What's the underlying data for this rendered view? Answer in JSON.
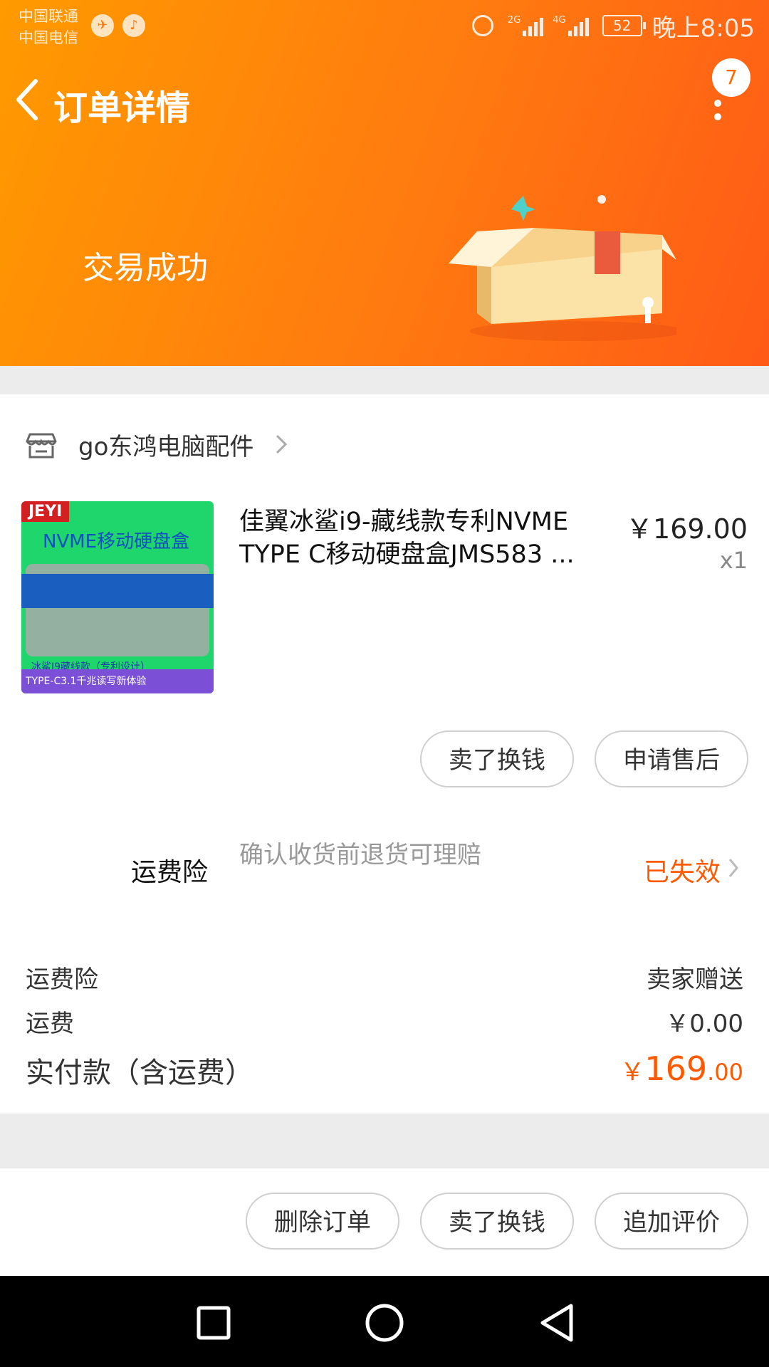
{
  "status_bar": {
    "carrier1": "中国联通",
    "carrier2": "中国电信",
    "net1": "2G",
    "net2": "4G",
    "battery": "52",
    "time": "晚上8:05"
  },
  "header": {
    "title": "订单详情",
    "badge_count": "7",
    "order_status": "交易成功"
  },
  "shop": {
    "name": "go东鸿电脑配件"
  },
  "product": {
    "name": "佳翼冰鲨i9-藏线款专利NVME TYPE C移动硬盘盒JMS583 ...",
    "price": "￥169.00",
    "quantity": "x1",
    "image_text": {
      "brand": "JEYI",
      "headline": "NVME移动硬盘盒",
      "sub": "冰鲨I9藏线款（专利设计）",
      "footer": "TYPE-C3.1千兆读写新体验"
    }
  },
  "item_actions": {
    "sell": "卖了换钱",
    "after_sale": "申请售后"
  },
  "insurance": {
    "label": "运费险",
    "description": "确认收货前退货可理赔",
    "state": "已失效"
  },
  "summary": {
    "insurance_label": "运费险",
    "insurance_value": "卖家赠送",
    "shipping_label": "运费",
    "shipping_value": "￥0.00",
    "paid_label": "实付款（含运费）",
    "paid_currency": "￥",
    "paid_integer": "169",
    "paid_decimal": ".00"
  },
  "bottom_actions": {
    "delete": "删除订单",
    "sell": "卖了换钱",
    "review": "追加评价"
  },
  "colors": {
    "accent": "#ff5a00",
    "header_start": "#ff9a00",
    "header_end": "#ff5a16"
  }
}
